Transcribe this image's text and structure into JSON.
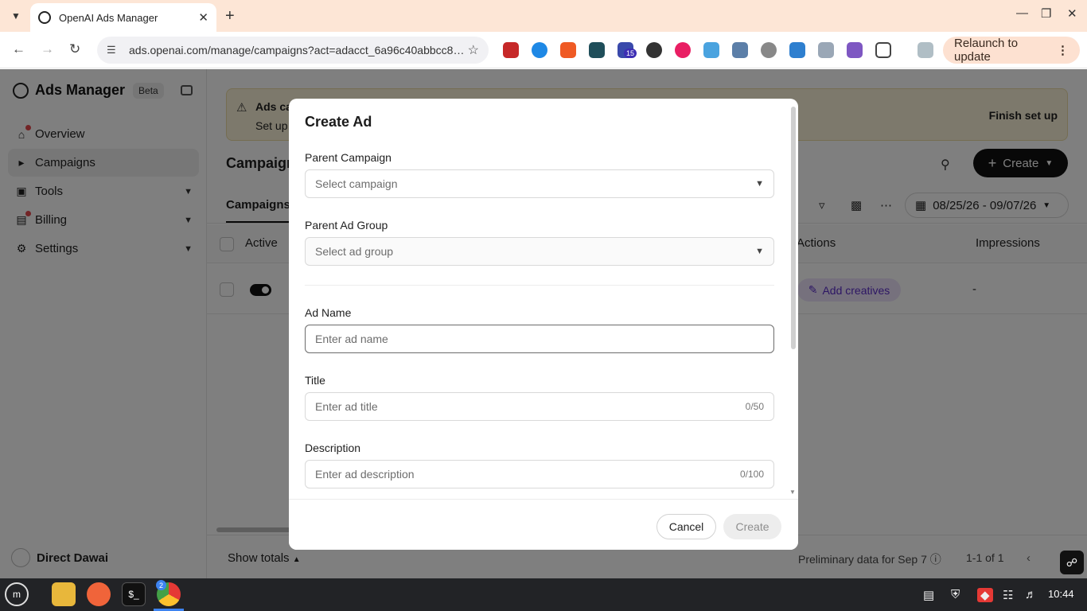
{
  "browser": {
    "tab_title": "OpenAI Ads Manager",
    "url": "ads.openai.com/manage/campaigns?act=adacct_6a96c40abbcc8…",
    "relaunch_label": "Relaunch to update",
    "extension_badge": "15"
  },
  "sidebar": {
    "brand": "Ads Manager",
    "beta": "Beta",
    "items": [
      {
        "label": "Overview"
      },
      {
        "label": "Campaigns"
      },
      {
        "label": "Tools"
      },
      {
        "label": "Billing"
      },
      {
        "label": "Settings"
      }
    ],
    "account_name": "Direct Dawai"
  },
  "banner": {
    "title": "Ads ca",
    "subtitle": "Set up",
    "action": "Finish set up"
  },
  "main": {
    "page_title": "Campaign",
    "create_label": "Create",
    "tab": "Campaigns",
    "date_range": "08/25/26 - 09/07/26",
    "columns": {
      "active": "Active",
      "actions": "Actions",
      "impressions": "Impressions"
    },
    "row": {
      "action": "Add creatives",
      "impressions": "-"
    }
  },
  "footer": {
    "show_totals": "Show totals",
    "preliminary": "Preliminary data for Sep 7",
    "count": "1-1 of 1"
  },
  "modal": {
    "title": "Create Ad",
    "parent_campaign_label": "Parent Campaign",
    "parent_campaign_placeholder": "Select campaign",
    "parent_ad_group_label": "Parent Ad Group",
    "parent_ad_group_placeholder": "Select ad group",
    "ad_name_label": "Ad Name",
    "ad_name_placeholder": "Enter ad name",
    "title_label": "Title",
    "title_placeholder": "Enter ad title",
    "title_counter": "0/50",
    "description_label": "Description",
    "description_placeholder": "Enter ad description",
    "description_counter": "0/100",
    "cancel_label": "Cancel",
    "create_label": "Create"
  },
  "taskbar": {
    "chrome_badge": "2",
    "clock": "10:44"
  }
}
